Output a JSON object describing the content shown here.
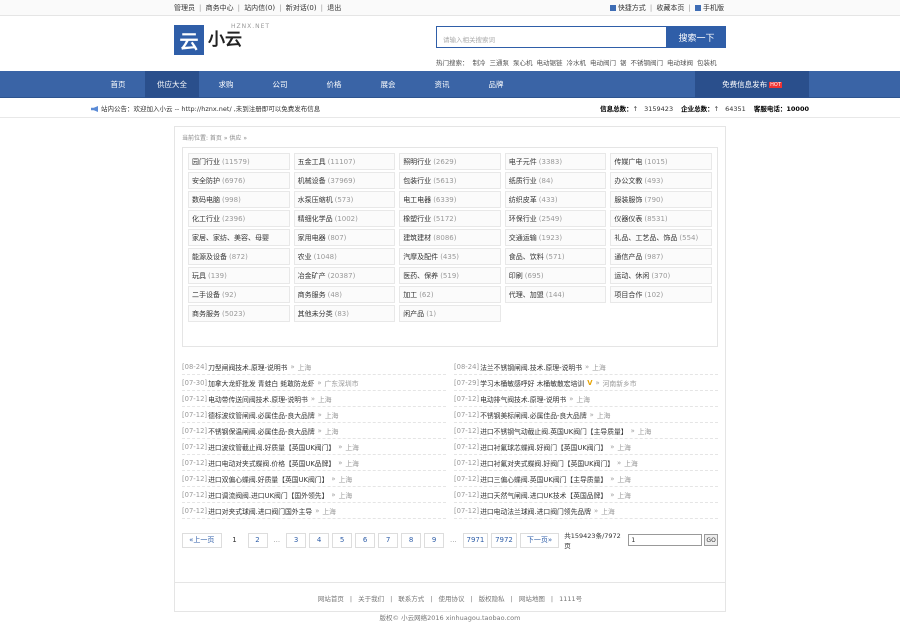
{
  "topbar": {
    "left": [
      "管理员",
      "商务中心",
      "站内信(0)",
      "新对话(0)",
      "退出"
    ],
    "right": [
      "快捷方式",
      "收藏本页",
      "手机版"
    ]
  },
  "logo": {
    "mark": "云",
    "name": "小云",
    "en": "HZNX.NET"
  },
  "search": {
    "placeholder": "请输入相关搜索词",
    "button": "搜索一下"
  },
  "hotwords": {
    "label": "热门搜索：",
    "items": [
      "制冷",
      "三通泵",
      "泵心机",
      "电动锯链",
      "冷水机",
      "电动阀门",
      "锯",
      "不锈钢阀门",
      "电动球阀",
      "包装机"
    ]
  },
  "nav": {
    "items": [
      "首页",
      "供应大全",
      "求购",
      "公司",
      "价格",
      "展会",
      "资讯",
      "品牌"
    ],
    "active": 1,
    "publish": "免费信息发布",
    "hot": "HOT"
  },
  "notice": {
    "text": "站内公告：欢迎加入小云 -- http://hznx.net/ ,未到注册即可以免费发布信息",
    "info_label": "信息总数：",
    "info_value": "3159423",
    "company_label": "企业总数：",
    "company_value": "64351",
    "phone_label": "客服电话：",
    "phone_value": "10000"
  },
  "crumb": "当前位置: 首页 » 供应 »",
  "categories": [
    {
      "name": "园门行业",
      "count": "(11579)"
    },
    {
      "name": "五金工具",
      "count": "(11107)"
    },
    {
      "name": "照明行业",
      "count": "(2629)"
    },
    {
      "name": "电子元件",
      "count": "(3383)"
    },
    {
      "name": "传媒广电",
      "count": "(1015)"
    },
    {
      "name": "安全防护",
      "count": "(6976)"
    },
    {
      "name": "机械设备",
      "count": "(37969)"
    },
    {
      "name": "包装行业",
      "count": "(5613)"
    },
    {
      "name": "纸质行业",
      "count": "(84)"
    },
    {
      "name": "办公文教",
      "count": "(493)"
    },
    {
      "name": "数码电脑",
      "count": "(998)"
    },
    {
      "name": "水泵压缩机",
      "count": "(573)"
    },
    {
      "name": "电工电器",
      "count": "(6339)"
    },
    {
      "name": "纺织皮革",
      "count": "(433)"
    },
    {
      "name": "服装服饰",
      "count": "(790)"
    },
    {
      "name": "化工行业",
      "count": "(2396)"
    },
    {
      "name": "精细化学品",
      "count": "(1002)"
    },
    {
      "name": "橡塑行业",
      "count": "(5172)"
    },
    {
      "name": "环保行业",
      "count": "(2549)"
    },
    {
      "name": "仪器仪表",
      "count": "(8531)"
    },
    {
      "name": "家居、家纺、美容、母婴",
      "count": ""
    },
    {
      "name": "家用电器",
      "count": "(807)"
    },
    {
      "name": "建筑建材",
      "count": "(8086)"
    },
    {
      "name": "交通运输",
      "count": "(1923)"
    },
    {
      "name": "礼品、工艺品、饰品",
      "count": "(554)"
    },
    {
      "name": "能源及设备",
      "count": "(872)"
    },
    {
      "name": "农业",
      "count": "(1048)"
    },
    {
      "name": "汽摩及配件",
      "count": "(435)"
    },
    {
      "name": "食品、饮料",
      "count": "(571)"
    },
    {
      "name": "通信产品",
      "count": "(987)"
    },
    {
      "name": "玩具",
      "count": "(139)"
    },
    {
      "name": "冶金矿产",
      "count": "(20387)"
    },
    {
      "name": "医药、保养",
      "count": "(519)"
    },
    {
      "name": "印刷",
      "count": "(695)"
    },
    {
      "name": "运动、休闲",
      "count": "(370)"
    },
    {
      "name": "二手设备",
      "count": "(92)"
    },
    {
      "name": "商务服务",
      "count": "(48)"
    },
    {
      "name": "加工",
      "count": "(62)"
    },
    {
      "name": "代理、加盟",
      "count": "(144)"
    },
    {
      "name": "项目合作",
      "count": "(102)"
    },
    {
      "name": "商务服务",
      "count": "(5023)"
    },
    {
      "name": "其他未分类",
      "count": "(83)"
    },
    {
      "name": "闲产品",
      "count": "(1)"
    }
  ],
  "news_left": [
    {
      "date": "[08-24]",
      "title": "刀型闸阀技术.原理-说明书",
      "loc": "上海",
      "badge": ""
    },
    {
      "date": "[07-30]",
      "title": "加拿大龙虾批发 青蛙白 蚝敢防龙虾",
      "loc": "广东深圳市",
      "badge": ""
    },
    {
      "date": "[07-12]",
      "title": "电动带传送间阀技术.原理-说明书",
      "loc": "上海",
      "badge": ""
    },
    {
      "date": "[07-12]",
      "title": "德标波纹管闸阀.必属佳品-良大品牌",
      "loc": "上海",
      "badge": ""
    },
    {
      "date": "[07-12]",
      "title": "不锈钢保温闸阀.必属佳品-良大品牌",
      "loc": "上海",
      "badge": ""
    },
    {
      "date": "[07-12]",
      "title": "进口波纹管截止阀.好质量【英国UK阀门】",
      "loc": "上海",
      "badge": ""
    },
    {
      "date": "[07-12]",
      "title": "进口电动对夹式蝶阀.价格【英国UK品牌】",
      "loc": "上海",
      "badge": ""
    },
    {
      "date": "[07-12]",
      "title": "进口双偏心蝶阀.好质量【英国UK阀门】",
      "loc": "上海",
      "badge": ""
    },
    {
      "date": "[07-12]",
      "title": "进口调流阀阀.进口UK阀门【国外领先】",
      "loc": "上海",
      "badge": ""
    },
    {
      "date": "[07-12]",
      "title": "进口对夹式球阀.进口阀门国外主导",
      "loc": "上海",
      "badge": ""
    }
  ],
  "news_right": [
    {
      "date": "[08-24]",
      "title": "法兰不锈钢闸阀.技术.原理-说明书",
      "loc": "上海",
      "badge": ""
    },
    {
      "date": "[07-29]",
      "title": "学习木桶敏感呼好 木桶敏散宏培训",
      "loc": "河南新乡市",
      "badge": "V"
    },
    {
      "date": "[07-12]",
      "title": "电动排气阀技术.原理-说明书",
      "loc": "上海",
      "badge": ""
    },
    {
      "date": "[07-12]",
      "title": "不锈钢美标闸阀.必属佳品-良大品牌",
      "loc": "上海",
      "badge": ""
    },
    {
      "date": "[07-12]",
      "title": "进口不锈钢气动截止阀.英国UK阀门【主导质量】",
      "loc": "上海",
      "badge": ""
    },
    {
      "date": "[07-12]",
      "title": "进口衬氟球芯蝶阀.好阀门【英国UK阀门】",
      "loc": "上海",
      "badge": ""
    },
    {
      "date": "[07-12]",
      "title": "进口衬氟对夹式蝶阀.好阀门【英国UK阀门】",
      "loc": "上海",
      "badge": ""
    },
    {
      "date": "[07-12]",
      "title": "进口三偏心蝶阀.英国UK阀门【主导质量】",
      "loc": "上海",
      "badge": ""
    },
    {
      "date": "[07-12]",
      "title": "进口天然气闸阀.进口UK技术【英国品牌】",
      "loc": "上海",
      "badge": ""
    },
    {
      "date": "[07-12]",
      "title": "进口电动法兰球阀.进口阀门领先品牌",
      "loc": "上海",
      "badge": ""
    }
  ],
  "pager": {
    "prev": "«上一页",
    "pages": [
      "1",
      "2",
      "...",
      "3",
      "4",
      "5",
      "6",
      "7",
      "8",
      "9",
      "...",
      "7971",
      "7972"
    ],
    "current": "1",
    "next": "下一页»",
    "total": "共159423条/7972页",
    "jump_value": "1",
    "go": "GO"
  },
  "footer": {
    "links": [
      "网站首页",
      "关于我们",
      "联系方式",
      "使用协议",
      "版权隐私",
      "网站地图",
      "1111号"
    ],
    "copy": "版权© 小云网络2016 xinhuagou.taobao.com"
  },
  "colors": {
    "brand": "#2f5ea8",
    "nav": "#3a64a6",
    "hot": "#ee3333"
  }
}
